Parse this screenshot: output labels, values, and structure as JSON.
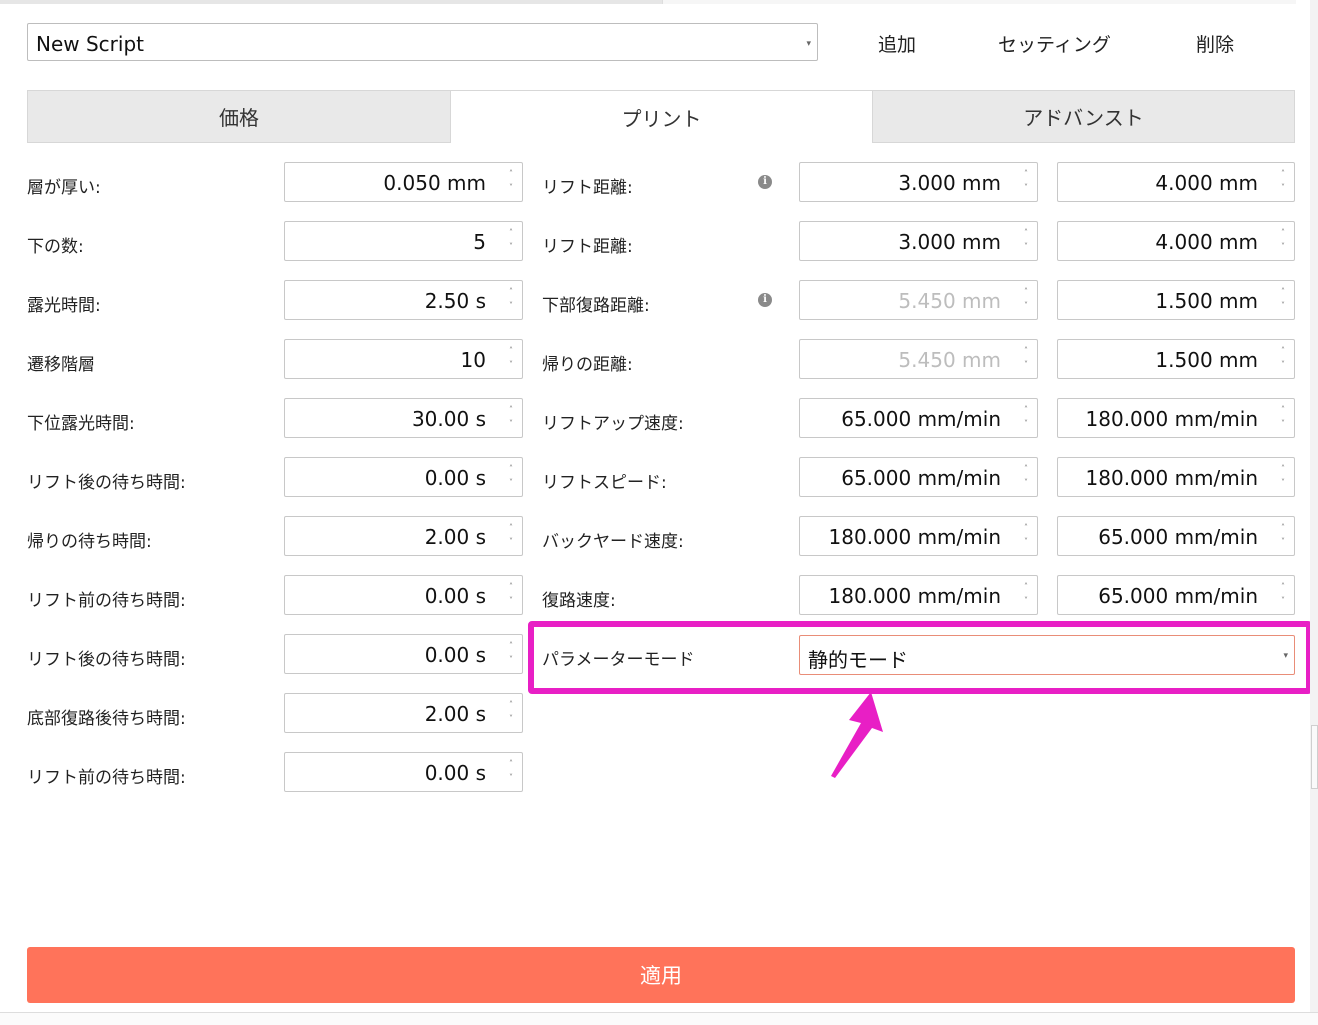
{
  "script": {
    "selected": "New Script"
  },
  "actions": {
    "add": "追加",
    "settings": "セッティング",
    "delete": "削除"
  },
  "tabs": [
    "価格",
    "プリント",
    "アドバンスト"
  ],
  "left_params": [
    {
      "label": "層が厚い:",
      "value": "0.050 mm"
    },
    {
      "label": "下の数:",
      "value": "5"
    },
    {
      "label": "露光時間:",
      "value": "2.50 s"
    },
    {
      "label": "遷移階層",
      "value": "10"
    },
    {
      "label": "下位露光時間:",
      "value": "30.00 s"
    },
    {
      "label": "リフト後の待ち時間:",
      "value": "0.00 s"
    },
    {
      "label": "帰りの待ち時間:",
      "value": "2.00 s"
    },
    {
      "label": "リフト前の待ち時間:",
      "value": "0.00 s"
    },
    {
      "label": "リフト後の待ち時間:",
      "value": "0.00 s"
    },
    {
      "label": "底部復路後待ち時間:",
      "value": "2.00 s"
    },
    {
      "label": "リフト前の待ち時間:",
      "value": "0.00 s"
    }
  ],
  "right_params": [
    {
      "label": "リフト距離:",
      "v1": "3.000 mm",
      "v2": "4.000 mm"
    },
    {
      "label": "リフト距離:",
      "v1": "3.000 mm",
      "v2": "4.000 mm"
    },
    {
      "label": "下部復路距離:",
      "v1": "5.450 mm",
      "v2": "1.500 mm"
    },
    {
      "label": "帰りの距離:",
      "v1": "5.450 mm",
      "v2": "1.500 mm"
    },
    {
      "label": "リフトアップ速度:",
      "v1": "65.000 mm/min",
      "v2": "180.000 mm/min"
    },
    {
      "label": "リフトスピード:",
      "v1": "65.000 mm/min",
      "v2": "180.000 mm/min"
    },
    {
      "label": "バックヤード速度:",
      "v1": "180.000 mm/min",
      "v2": "65.000 mm/min"
    },
    {
      "label": "復路速度:",
      "v1": "180.000 mm/min",
      "v2": "65.000 mm/min"
    }
  ],
  "mode": {
    "label": "パラメーターモード",
    "value": "静的モード"
  },
  "apply": "適用",
  "colors": {
    "accent": "#ff735a",
    "highlight": "#e81fc5"
  },
  "icons": {
    "info": "info-icon",
    "caret": "chevron-down-icon",
    "spinner": "spinner-arrows-icon"
  }
}
